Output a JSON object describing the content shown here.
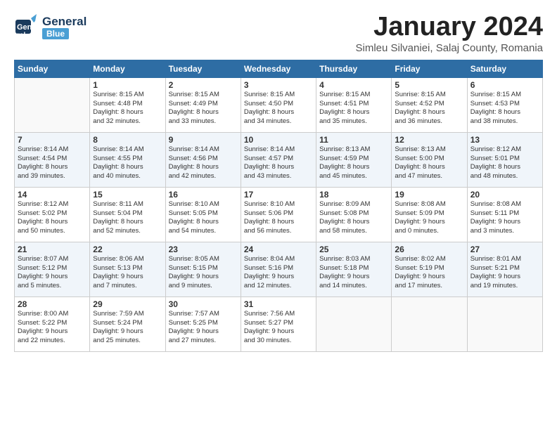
{
  "logo": {
    "general": "General",
    "blue": "Blue"
  },
  "title": "January 2024",
  "subtitle": "Simleu Silvaniei, Salaj County, Romania",
  "days_of_week": [
    "Sunday",
    "Monday",
    "Tuesday",
    "Wednesday",
    "Thursday",
    "Friday",
    "Saturday"
  ],
  "weeks": [
    [
      {
        "day": "",
        "info": ""
      },
      {
        "day": "1",
        "info": "Sunrise: 8:15 AM\nSunset: 4:48 PM\nDaylight: 8 hours\nand 32 minutes."
      },
      {
        "day": "2",
        "info": "Sunrise: 8:15 AM\nSunset: 4:49 PM\nDaylight: 8 hours\nand 33 minutes."
      },
      {
        "day": "3",
        "info": "Sunrise: 8:15 AM\nSunset: 4:50 PM\nDaylight: 8 hours\nand 34 minutes."
      },
      {
        "day": "4",
        "info": "Sunrise: 8:15 AM\nSunset: 4:51 PM\nDaylight: 8 hours\nand 35 minutes."
      },
      {
        "day": "5",
        "info": "Sunrise: 8:15 AM\nSunset: 4:52 PM\nDaylight: 8 hours\nand 36 minutes."
      },
      {
        "day": "6",
        "info": "Sunrise: 8:15 AM\nSunset: 4:53 PM\nDaylight: 8 hours\nand 38 minutes."
      }
    ],
    [
      {
        "day": "7",
        "info": "Sunrise: 8:14 AM\nSunset: 4:54 PM\nDaylight: 8 hours\nand 39 minutes."
      },
      {
        "day": "8",
        "info": "Sunrise: 8:14 AM\nSunset: 4:55 PM\nDaylight: 8 hours\nand 40 minutes."
      },
      {
        "day": "9",
        "info": "Sunrise: 8:14 AM\nSunset: 4:56 PM\nDaylight: 8 hours\nand 42 minutes."
      },
      {
        "day": "10",
        "info": "Sunrise: 8:14 AM\nSunset: 4:57 PM\nDaylight: 8 hours\nand 43 minutes."
      },
      {
        "day": "11",
        "info": "Sunrise: 8:13 AM\nSunset: 4:59 PM\nDaylight: 8 hours\nand 45 minutes."
      },
      {
        "day": "12",
        "info": "Sunrise: 8:13 AM\nSunset: 5:00 PM\nDaylight: 8 hours\nand 47 minutes."
      },
      {
        "day": "13",
        "info": "Sunrise: 8:12 AM\nSunset: 5:01 PM\nDaylight: 8 hours\nand 48 minutes."
      }
    ],
    [
      {
        "day": "14",
        "info": "Sunrise: 8:12 AM\nSunset: 5:02 PM\nDaylight: 8 hours\nand 50 minutes."
      },
      {
        "day": "15",
        "info": "Sunrise: 8:11 AM\nSunset: 5:04 PM\nDaylight: 8 hours\nand 52 minutes."
      },
      {
        "day": "16",
        "info": "Sunrise: 8:10 AM\nSunset: 5:05 PM\nDaylight: 8 hours\nand 54 minutes."
      },
      {
        "day": "17",
        "info": "Sunrise: 8:10 AM\nSunset: 5:06 PM\nDaylight: 8 hours\nand 56 minutes."
      },
      {
        "day": "18",
        "info": "Sunrise: 8:09 AM\nSunset: 5:08 PM\nDaylight: 8 hours\nand 58 minutes."
      },
      {
        "day": "19",
        "info": "Sunrise: 8:08 AM\nSunset: 5:09 PM\nDaylight: 9 hours\nand 0 minutes."
      },
      {
        "day": "20",
        "info": "Sunrise: 8:08 AM\nSunset: 5:11 PM\nDaylight: 9 hours\nand 3 minutes."
      }
    ],
    [
      {
        "day": "21",
        "info": "Sunrise: 8:07 AM\nSunset: 5:12 PM\nDaylight: 9 hours\nand 5 minutes."
      },
      {
        "day": "22",
        "info": "Sunrise: 8:06 AM\nSunset: 5:13 PM\nDaylight: 9 hours\nand 7 minutes."
      },
      {
        "day": "23",
        "info": "Sunrise: 8:05 AM\nSunset: 5:15 PM\nDaylight: 9 hours\nand 9 minutes."
      },
      {
        "day": "24",
        "info": "Sunrise: 8:04 AM\nSunset: 5:16 PM\nDaylight: 9 hours\nand 12 minutes."
      },
      {
        "day": "25",
        "info": "Sunrise: 8:03 AM\nSunset: 5:18 PM\nDaylight: 9 hours\nand 14 minutes."
      },
      {
        "day": "26",
        "info": "Sunrise: 8:02 AM\nSunset: 5:19 PM\nDaylight: 9 hours\nand 17 minutes."
      },
      {
        "day": "27",
        "info": "Sunrise: 8:01 AM\nSunset: 5:21 PM\nDaylight: 9 hours\nand 19 minutes."
      }
    ],
    [
      {
        "day": "28",
        "info": "Sunrise: 8:00 AM\nSunset: 5:22 PM\nDaylight: 9 hours\nand 22 minutes."
      },
      {
        "day": "29",
        "info": "Sunrise: 7:59 AM\nSunset: 5:24 PM\nDaylight: 9 hours\nand 25 minutes."
      },
      {
        "day": "30",
        "info": "Sunrise: 7:57 AM\nSunset: 5:25 PM\nDaylight: 9 hours\nand 27 minutes."
      },
      {
        "day": "31",
        "info": "Sunrise: 7:56 AM\nSunset: 5:27 PM\nDaylight: 9 hours\nand 30 minutes."
      },
      {
        "day": "",
        "info": ""
      },
      {
        "day": "",
        "info": ""
      },
      {
        "day": "",
        "info": ""
      }
    ]
  ]
}
